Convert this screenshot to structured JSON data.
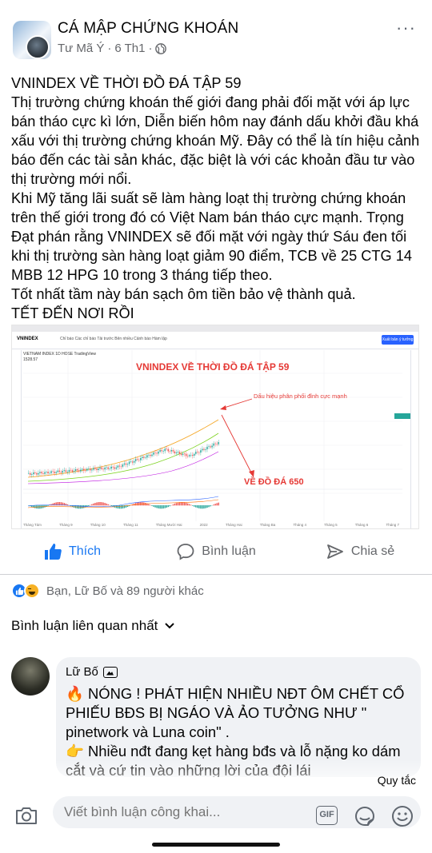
{
  "post": {
    "group_name": "CÁ MẬP CHỨNG KHOÁN",
    "author": "Tư Mã Ý",
    "time": "6 Th1",
    "separator": "·",
    "more": "···",
    "body": [
      "VNINDEX VỀ THỜI ĐỒ ĐÁ TẬP 59",
      "Thị trường chứng khoán thế giới đang phải đối mặt với áp lực bán tháo cực kì lớn, Diễn biến hôm nay đánh dấu khởi đầu khá xấu với thị trường chứng khoán Mỹ. Đây có thể là tín hiệu cảnh báo đến các tài sản khác, đặc biệt là với các khoản đầu tư vào thị trường mới nổi.",
      "Khi Mỹ tăng lãi suất sẽ làm hàng loạt thị trường chứng khoán trên thế giới trong đó có Việt Nam bán tháo cực mạnh. Trọng Đạt phán rằng VNINDEX sẽ đối mặt với ngày thứ Sáu đen tối khi thị trường sàn hàng loạt giảm 90 điểm, TCB về 25 CTG 14 MBB 12 HPG 10 trong 3 tháng tiếp theo.",
      "Tốt nhất tầm này bán sạch ôm tiền bảo vệ thành quả.",
      "TẾT ĐẾN NƠI RỒI"
    ]
  },
  "chart_image": {
    "symbol": "VNINDEX",
    "tools": "Chỉ báo   Các chỉ báo   Tải trước   Bên nhiều   Cảnh báo   Hàm lập",
    "publish": "Xuất bản ý tưởng",
    "info_line1": "VIETNAM INDEX  1D  HOSE  TradingView",
    "info_line2": "1528.57",
    "title": "VNINDEX VỀ THỜI ĐỒ ĐÁ TẬP 59",
    "note": "Dấu hiệu phân phối đỉnh cực mạnh",
    "target": "VỀ ĐỒ ĐÁ 650",
    "xaxis": [
      "Tháng Tám",
      "Tháng 9",
      "Tháng 10",
      "Tháng 11",
      "Tháng Mười Hai",
      "2022",
      "Tháng Hai",
      "Tháng Ba",
      "Tháng 4",
      "Tháng 5",
      "Tháng 6",
      "Tháng 7"
    ]
  },
  "actions": {
    "like": "Thích",
    "comment": "Bình luận",
    "share": "Chia sẻ"
  },
  "reactions": {
    "summary": "Bạn, Lữ Bố và 89 người khác"
  },
  "comments_sort": {
    "label": "Bình luận liên quan nhất"
  },
  "comment": {
    "author": "Lữ Bố",
    "lines": [
      "🔥 NÓNG ! PHÁT HIỆN NHIỀU NĐT ÔM CHẾT CỔ PHIẾU BĐS BỊ NGÁO VÀ ẢO TƯỞNG NHƯ \" pinetwork và Luna coin\" .",
      "👉 Nhiều nđt đang kẹt hàng bđs và lỗ nặng ko dám cắt và cứ tin vào những lời của đội lái"
    ]
  },
  "footer": {
    "rules": "Quy tắc",
    "placeholder": "Viết bình luận công khai...",
    "gif": "GIF"
  },
  "colors": {
    "accent": "#1877f2",
    "annotation": "#e53935",
    "bubble": "#f0f2f5"
  }
}
